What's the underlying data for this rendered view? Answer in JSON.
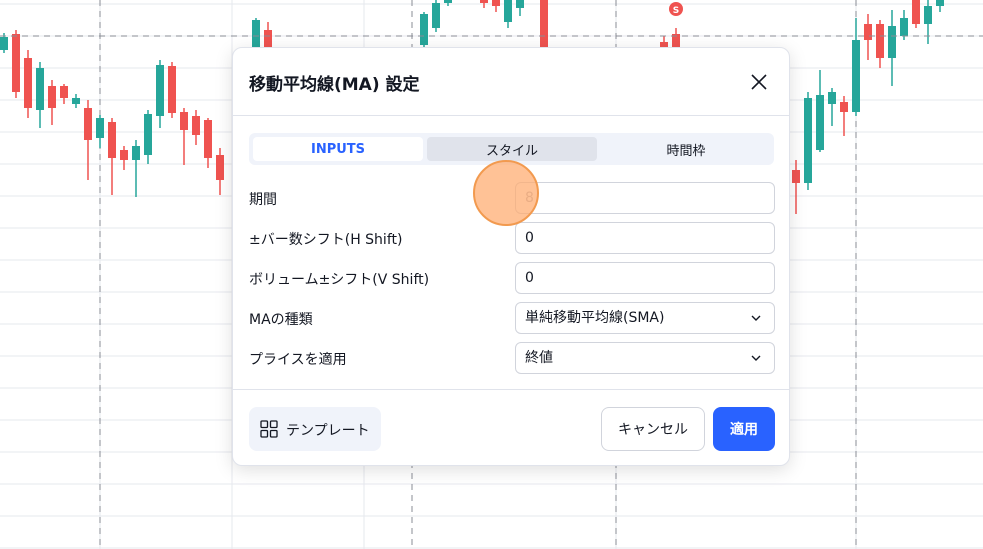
{
  "chart": {
    "marker_label": "S",
    "colors": {
      "up": "#26a69a",
      "down": "#ef5350",
      "grid": "#e6e8ee",
      "crosshair": "#8a8d96"
    }
  },
  "dialog": {
    "title": "移動平均線(MA) 設定",
    "tabs": [
      {
        "label": "INPUTS",
        "active": true
      },
      {
        "label": "スタイル",
        "active": false
      },
      {
        "label": "時間枠",
        "active": false
      }
    ],
    "rows": [
      {
        "label": "期間",
        "value": "8"
      },
      {
        "label": "±バー数シフト(H Shift)",
        "value": "0"
      },
      {
        "label": "ボリューム±シフト(V Shift)",
        "value": "0"
      },
      {
        "label": "MAの種類",
        "value": "単純移動平均線(SMA)"
      },
      {
        "label": "プライスを適用",
        "value": "終値"
      }
    ],
    "template_label": "テンプレート",
    "cancel_label": "キャンセル",
    "apply_label": "適用",
    "icons": {
      "close": "close-icon",
      "template": "grid-icon",
      "dropdown": "chevron-down-icon"
    }
  }
}
